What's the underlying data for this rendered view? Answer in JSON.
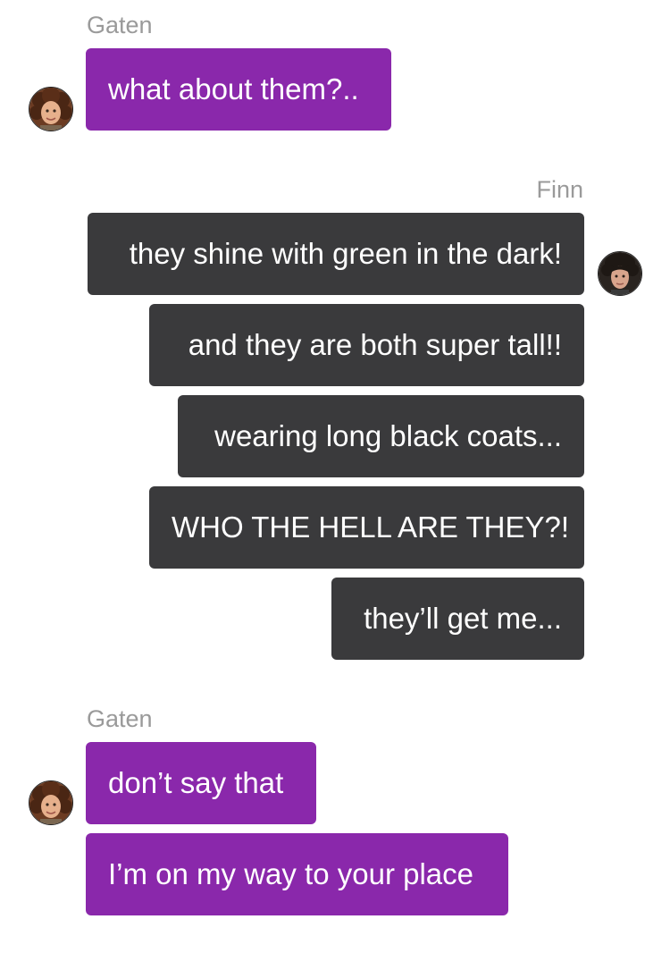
{
  "chat": {
    "groups": [
      {
        "sender": "Gaten",
        "messages": [
          "what about them?.."
        ]
      },
      {
        "sender": "Finn",
        "messages": [
          "they shine with green in the dark!",
          "and they are both super tall!!",
          "wearing long black coats...",
          "WHO THE HELL ARE THEY?!",
          "they’ll get me..."
        ]
      },
      {
        "sender": "Gaten",
        "messages": [
          "don’t say that",
          "I’m on my way to your place"
        ]
      }
    ]
  },
  "colors": {
    "gaten_bubble": "#8a28ab",
    "finn_bubble": "#3a3a3c",
    "sender_name": "#9a9a9a"
  }
}
